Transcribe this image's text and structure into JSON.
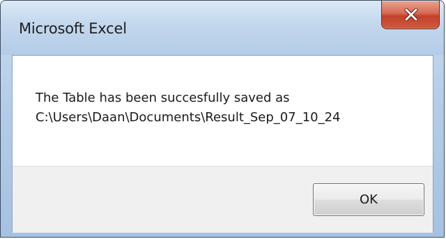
{
  "window": {
    "title": "Microsoft Excel"
  },
  "titlebar": {
    "close_icon": "close-icon",
    "close_color": "#c94a33"
  },
  "message": {
    "line1": "The Table has been succesfully saved as",
    "line2": "C:\\Users\\Daan\\Documents\\Result_Sep_07_10_24"
  },
  "buttons": {
    "ok_label": "OK"
  }
}
